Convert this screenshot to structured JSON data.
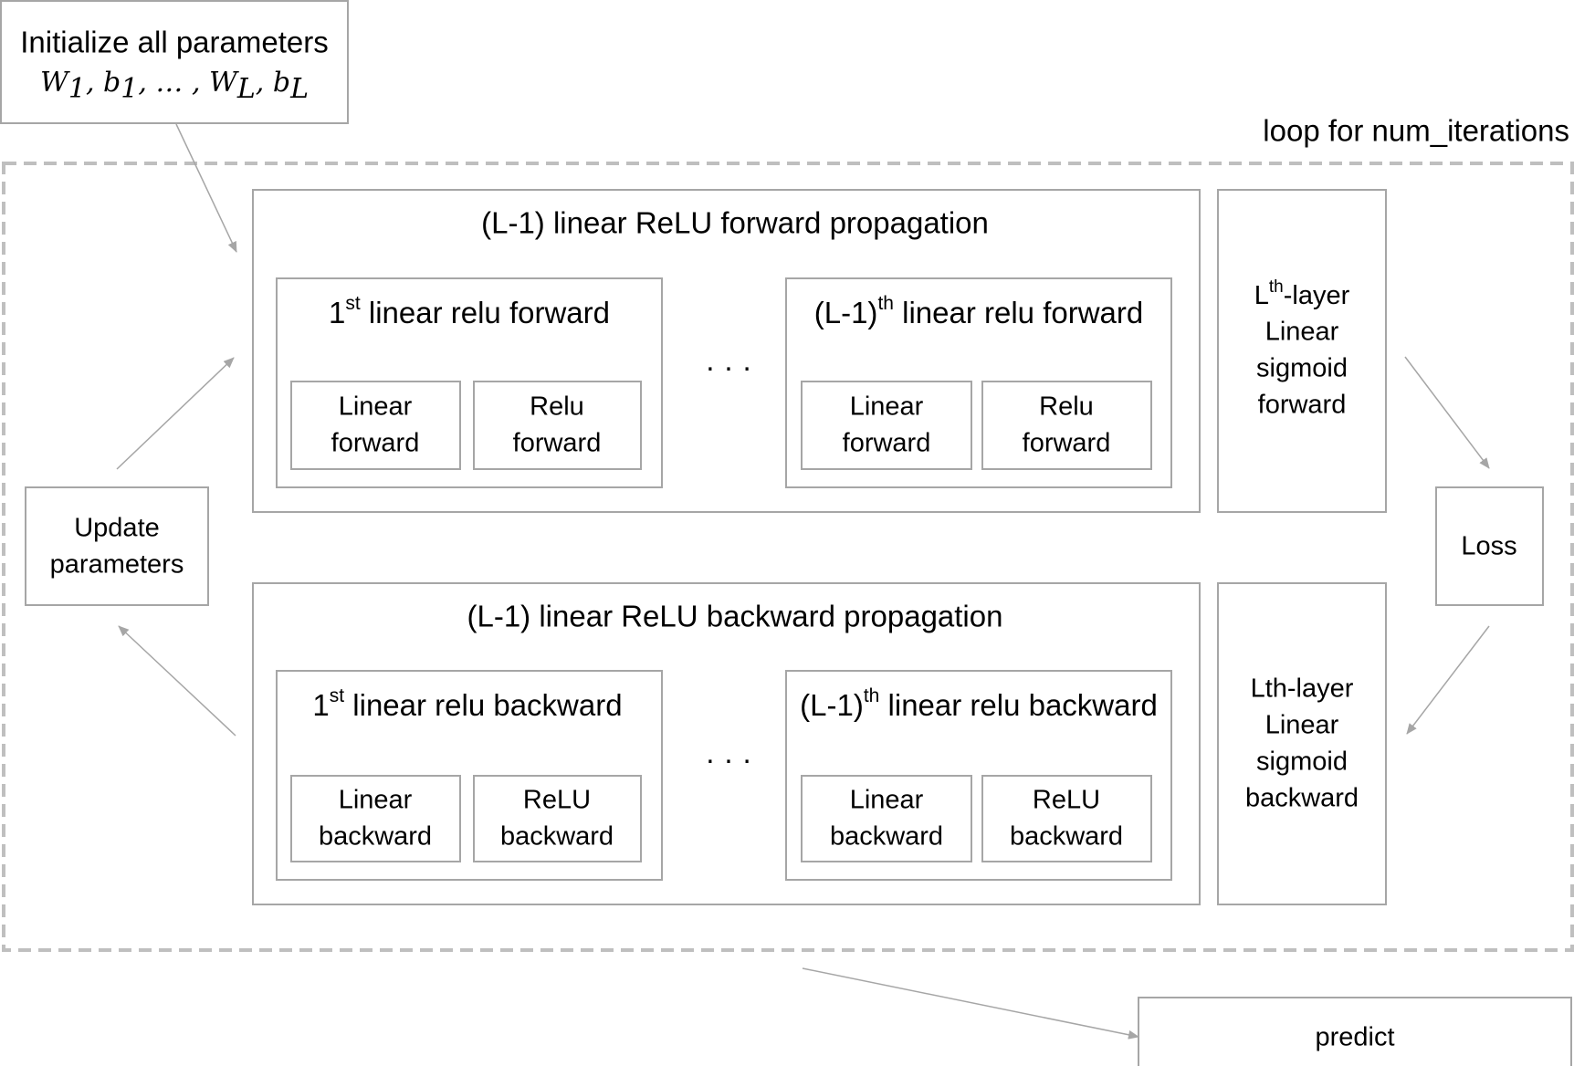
{
  "init": {
    "line1": "Initialize all parameters",
    "W": "W",
    "b": "b",
    "sub1": "1",
    "subL": "L",
    "comma": ", ",
    "ellipsis": "… , "
  },
  "loop_label": "loop for num_iterations",
  "forward": {
    "title": "(L-1) linear ReLU forward propagation",
    "first": {
      "pre": "1",
      "sup": "st",
      "post": " linear relu forward",
      "boxes": [
        [
          "Linear",
          "forward"
        ],
        [
          "Relu",
          "forward"
        ]
      ]
    },
    "last": {
      "pre": "(L-1)",
      "sup": "th",
      "post": " linear relu forward",
      "boxes": [
        [
          "Linear",
          "forward"
        ],
        [
          "Relu",
          "forward"
        ]
      ]
    },
    "dots": "· · ·"
  },
  "backward": {
    "title": "(L-1) linear ReLU backward propagation",
    "first": {
      "pre": "1",
      "sup": "st",
      "post": " linear relu backward",
      "boxes": [
        [
          "Linear",
          "backward"
        ],
        [
          "ReLU",
          "backward"
        ]
      ]
    },
    "last": {
      "pre": "(L-1)",
      "sup": "th",
      "post": " linear relu backward",
      "boxes": [
        [
          "Linear",
          "backward"
        ],
        [
          "ReLU",
          "backward"
        ]
      ]
    },
    "dots": "· · ·"
  },
  "lth_forward": {
    "pre": "L",
    "sup": "th",
    "post": "-layer",
    "lines": [
      "Linear",
      "sigmoid",
      "forward"
    ]
  },
  "lth_backward": {
    "lines": [
      "Lth-layer",
      "Linear",
      "sigmoid",
      "backward"
    ]
  },
  "loss": "Loss",
  "update": [
    "Update",
    "parameters"
  ],
  "predict": "predict"
}
